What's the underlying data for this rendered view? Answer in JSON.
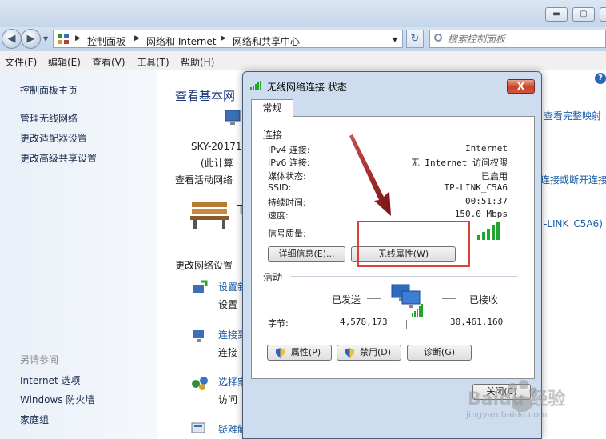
{
  "nav": {
    "breadcrumbs": [
      "控制面板",
      "网络和 Internet",
      "网络和共享中心"
    ],
    "search_placeholder": "搜索控制面板"
  },
  "menu": [
    "文件(F)",
    "编辑(E)",
    "查看(V)",
    "工具(T)",
    "帮助(H)"
  ],
  "left": {
    "links": [
      "控制面板主页",
      "管理无线网络",
      "更改适配器设置",
      "更改高级共享设置"
    ],
    "see_also_title": "另请参阅",
    "see_also": [
      "Internet 选项",
      "Windows 防火墙",
      "家庭组"
    ]
  },
  "main": {
    "title_partial": "查看基本网",
    "view_full_map": "查看完整映射",
    "computer_name_partial": "SKY-20171",
    "computer_sub_partial": "(此计算",
    "active_networks": "查看活动网络",
    "connect_disconnect_partial": "连接或断开连接",
    "network_name_partial": "-LINK_C5A6)",
    "change_settings": "更改网络设置",
    "items": [
      {
        "link": "设置新",
        "desc": "设置"
      },
      {
        "link": "连接到",
        "desc": "连接"
      },
      {
        "link": "选择家",
        "desc": "访问"
      },
      {
        "link": "疑难解答",
        "desc": ""
      }
    ]
  },
  "dialog": {
    "title": "无线网络连接 状态",
    "close": "X",
    "tab": "常规",
    "connection_title": "连接",
    "rows": [
      {
        "label": "IPv4 连接:",
        "value": "Internet"
      },
      {
        "label": "IPv6 连接:",
        "value": "无 Internet 访问权限"
      },
      {
        "label": "媒体状态:",
        "value": "已启用"
      },
      {
        "label": "SSID:",
        "value": "TP-LINK_C5A6"
      },
      {
        "label": "持续时间:",
        "value": "00:51:37"
      },
      {
        "label": "速度:",
        "value": "150.0 Mbps"
      }
    ],
    "signal_label": "信号质量:",
    "signal_bars": 5,
    "details_button": "详细信息(E)...",
    "wireless_props_button": "无线属性(W)",
    "activity_title": "活动",
    "sent_label": "已发送",
    "received_label": "已接收",
    "bytes_label": "字节:",
    "bytes_sent": "4,578,173",
    "bytes_received": "30,461,160",
    "properties_button": "属性(P)",
    "disable_button": "禁用(D)",
    "diagnose_button": "诊断(G)",
    "close_button": "关闭(C)"
  },
  "colors": {
    "highlight_box": "#d9413a",
    "link": "#1b5da8",
    "signal": "#22a52f"
  },
  "watermark": "Baidu 经验",
  "watermark_url": "jingyan.baidu.com"
}
